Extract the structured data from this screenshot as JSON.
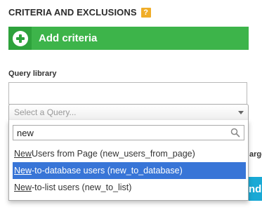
{
  "section": {
    "title": "CRITERIA AND EXCLUSIONS",
    "help_badge": "?"
  },
  "add_criteria": {
    "label": "Add criteria",
    "icon": "plus-circle-icon"
  },
  "query_library": {
    "label": "Query library",
    "text_value": "",
    "select_placeholder": "Select a Query..."
  },
  "dropdown": {
    "search_value": "new",
    "search_icon": "search-icon",
    "items": [
      {
        "match": "New",
        "rest": " Users from Page (new_users_from_page)",
        "highlighted": false
      },
      {
        "match": "New",
        "rest": "-to-database users (new_to_database)",
        "highlighted": true
      },
      {
        "match": "New",
        "rest": "-to-list users (new_to_list)",
        "highlighted": false
      }
    ]
  },
  "background": {
    "partial_text": "arge",
    "partial_button": "nd s"
  },
  "colors": {
    "green": "#3db44a",
    "highlight": "#3875d7",
    "blue_button": "#19a9d5",
    "help_badge": "#f0ad28"
  }
}
